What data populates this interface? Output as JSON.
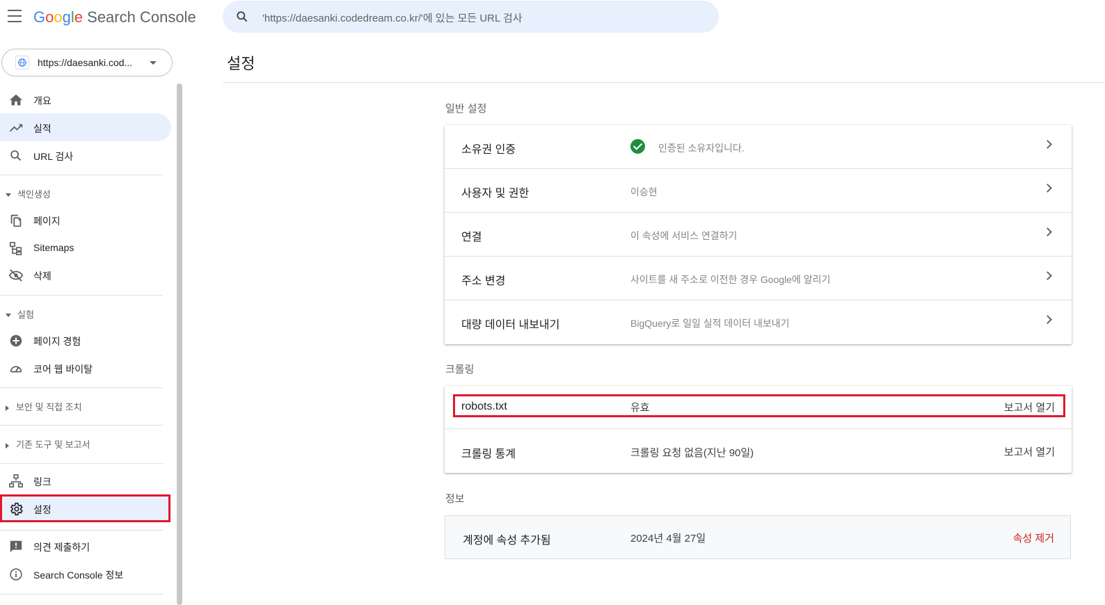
{
  "header": {
    "logo_google": [
      "G",
      "o",
      "o",
      "g",
      "l",
      "e"
    ],
    "logo_product": "Search Console",
    "search_placeholder": "'https://daesanki.codedream.co.kr/'에 있는 모든 URL 검사"
  },
  "property": {
    "label": "https://daesanki.cod..."
  },
  "sidebar": {
    "items": [
      {
        "label": "개요",
        "icon": "home-icon"
      },
      {
        "label": "실적",
        "icon": "trending-up-icon"
      },
      {
        "label": "URL 검사",
        "icon": "search-icon"
      },
      {
        "label": "페이지",
        "icon": "pages-icon"
      },
      {
        "label": "Sitemaps",
        "icon": "sitemap-icon"
      },
      {
        "label": "삭제",
        "icon": "visibility-off-icon"
      },
      {
        "label": "페이지 경험",
        "icon": "add-circle-icon"
      },
      {
        "label": "코어 웹 바이탈",
        "icon": "speed-gauge-icon"
      },
      {
        "label": "링크",
        "icon": "links-icon"
      },
      {
        "label": "설정",
        "icon": "gear-icon"
      },
      {
        "label": "의견 제출하기",
        "icon": "feedback-icon"
      },
      {
        "label": "Search Console 정보",
        "icon": "info-icon"
      }
    ],
    "sections": {
      "indexing": "색인생성",
      "experience": "실험",
      "security": "보안 및 직접 조치",
      "legacy": "기존 도구 및 보고서"
    },
    "active": "실적",
    "selected": "설정"
  },
  "main": {
    "title": "설정",
    "general": {
      "heading": "일반 설정",
      "rows": [
        {
          "label": "소유권 인증",
          "value": "인증된 소유자입니다."
        },
        {
          "label": "사용자 및 권한",
          "value": "이승현"
        },
        {
          "label": "연결",
          "value": "이 속성에 서비스 연결하기"
        },
        {
          "label": "주소 변경",
          "value": "사이트를 새 주소로 이전한 경우 Google에 알리기"
        },
        {
          "label": "대량 데이터 내보내기",
          "value": "BigQuery로 일일 실적 데이터 내보내기"
        }
      ]
    },
    "crawling": {
      "heading": "크롤링",
      "rows": [
        {
          "label": "robots.txt",
          "value": "유효",
          "action": "보고서 열기"
        },
        {
          "label": "크롤링 통계",
          "value": "크롤링 요청 없음(지난 90일)",
          "action": "보고서 열기"
        }
      ]
    },
    "about": {
      "heading": "정보",
      "label": "계정에 속성 추가됨",
      "value": "2024년 4월 27일",
      "action": "속성 제거"
    }
  },
  "colors": {
    "accent_bg": "#e8f0fe",
    "highlight": "#e0182d",
    "verified": "#1e8e3e",
    "danger": "#c5221f"
  }
}
